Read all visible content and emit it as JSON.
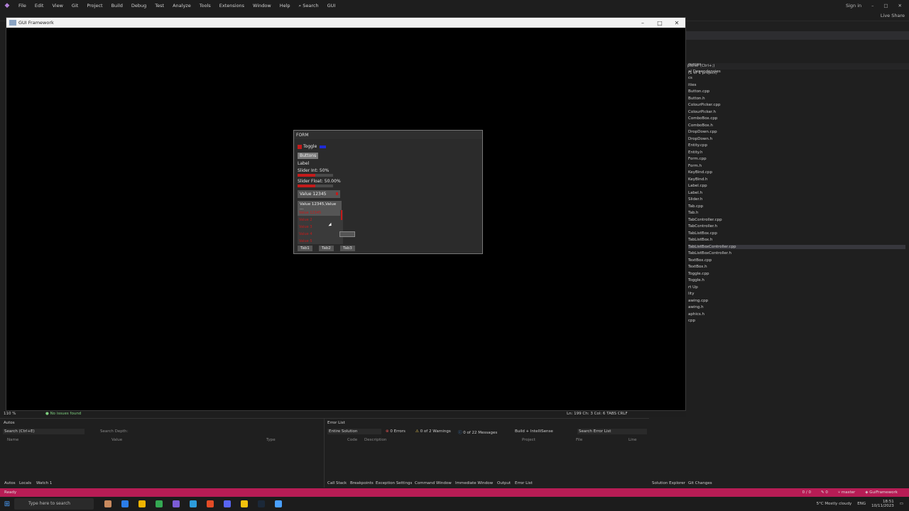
{
  "menu": {
    "items": [
      "File",
      "Edit",
      "View",
      "Git",
      "Project",
      "Build",
      "Debug",
      "Test",
      "Analyze",
      "Tools",
      "Extensions",
      "Window",
      "Help"
    ],
    "search_label": "Search",
    "solution_name": "GUI",
    "sign_in": "Sign in",
    "live_share": "Live Share"
  },
  "gui_window": {
    "title": "GUI Framework",
    "form": {
      "title": "FORM",
      "toggle_label": "Toggle",
      "buttons_label": "Buttons",
      "label_text": "Label",
      "slider_int_label": "Slider Int: 50%",
      "slider_int_value": 0.5,
      "slider_float_label": "Slider Float: 50.00%",
      "slider_float_value": 0.5,
      "combo_value": "Value 12345",
      "multi_combo_value": "Value 12345,Value ...",
      "list_items": [
        "Value 12345",
        "Value 2",
        "Value 3",
        "Value 4",
        "Value 5"
      ],
      "tabs": [
        "Tab1",
        "Tab2",
        "Tab3"
      ],
      "colors": {
        "accent_red": "#c41b1b",
        "toggle_blue": "#1f2bd6"
      }
    }
  },
  "solution_explorer": {
    "search_hint": "plorer (Ctrl+;)",
    "project_count": "(1 of 1 project)",
    "items": [
      "ources",
      "al Dependencies",
      "cs",
      "ities",
      "Button.cpp",
      "Button.h",
      "ColourPicker.cpp",
      "ColourPicker.h",
      "ComboBox.cpp",
      "ComboBox.h",
      "DropDown.cpp",
      "DropDown.h",
      "Entity.cpp",
      "Entity.h",
      "Form.cpp",
      "Form.h",
      "KeyBind.cpp",
      "KeyBind.h",
      "Label.cpp",
      "Label.h",
      "Slider.h",
      "Tab.cpp",
      "Tab.h",
      "TabController.cpp",
      "TabController.h",
      "TabListBox.cpp",
      "TabListBox.h",
      "TabListBoxController.cpp",
      "TabListBoxController.h",
      "TextBox.cpp",
      "TextBox.h",
      "Toggle.cpp",
      "Toggle.h",
      "rt Up",
      "lity",
      "awing.cpp",
      "awing.h",
      "aphics.h",
      "cpp"
    ],
    "selected": "TabListBoxController.cpp"
  },
  "editor_status": {
    "zoom": "110 %",
    "issues": "No issues found",
    "position": "Ln: 199   Ch: 3   Col: 6   TABS   CRLF"
  },
  "autos": {
    "title": "Autos",
    "search_placeholder": "Search (Ctrl+E)",
    "search_depth": "Search Depth:",
    "columns": [
      "Name",
      "Value",
      "Type"
    ],
    "bottom_tabs": [
      "Autos",
      "Locals",
      "Watch 1"
    ]
  },
  "error_list": {
    "title": "Error List",
    "scope": "Entire Solution",
    "errors": "0 Errors",
    "warnings": "0 of 2 Warnings",
    "messages": "0 of 22 Messages",
    "build_filter": "Build + IntelliSense",
    "search_placeholder": "Search Error List",
    "columns": [
      "Code",
      "Description",
      "Project",
      "File",
      "Line"
    ],
    "bottom_tabs": [
      "Call Stack",
      "Breakpoints",
      "Exception Settings",
      "Command Window",
      "Immediate Window",
      "Output",
      "Error List"
    ]
  },
  "right_tabs": [
    "Solution Explorer",
    "Git Changes"
  ],
  "status_bar": {
    "ready": "Ready",
    "lines": "0 / 0",
    "pencil": "0",
    "branch": "master",
    "repo": "GuiFramework"
  },
  "taskbar": {
    "search_placeholder": "Type here to search",
    "weather": "5°C  Mostly cloudy",
    "lang": "ENG",
    "time": "18:51",
    "date": "10/11/2023"
  }
}
